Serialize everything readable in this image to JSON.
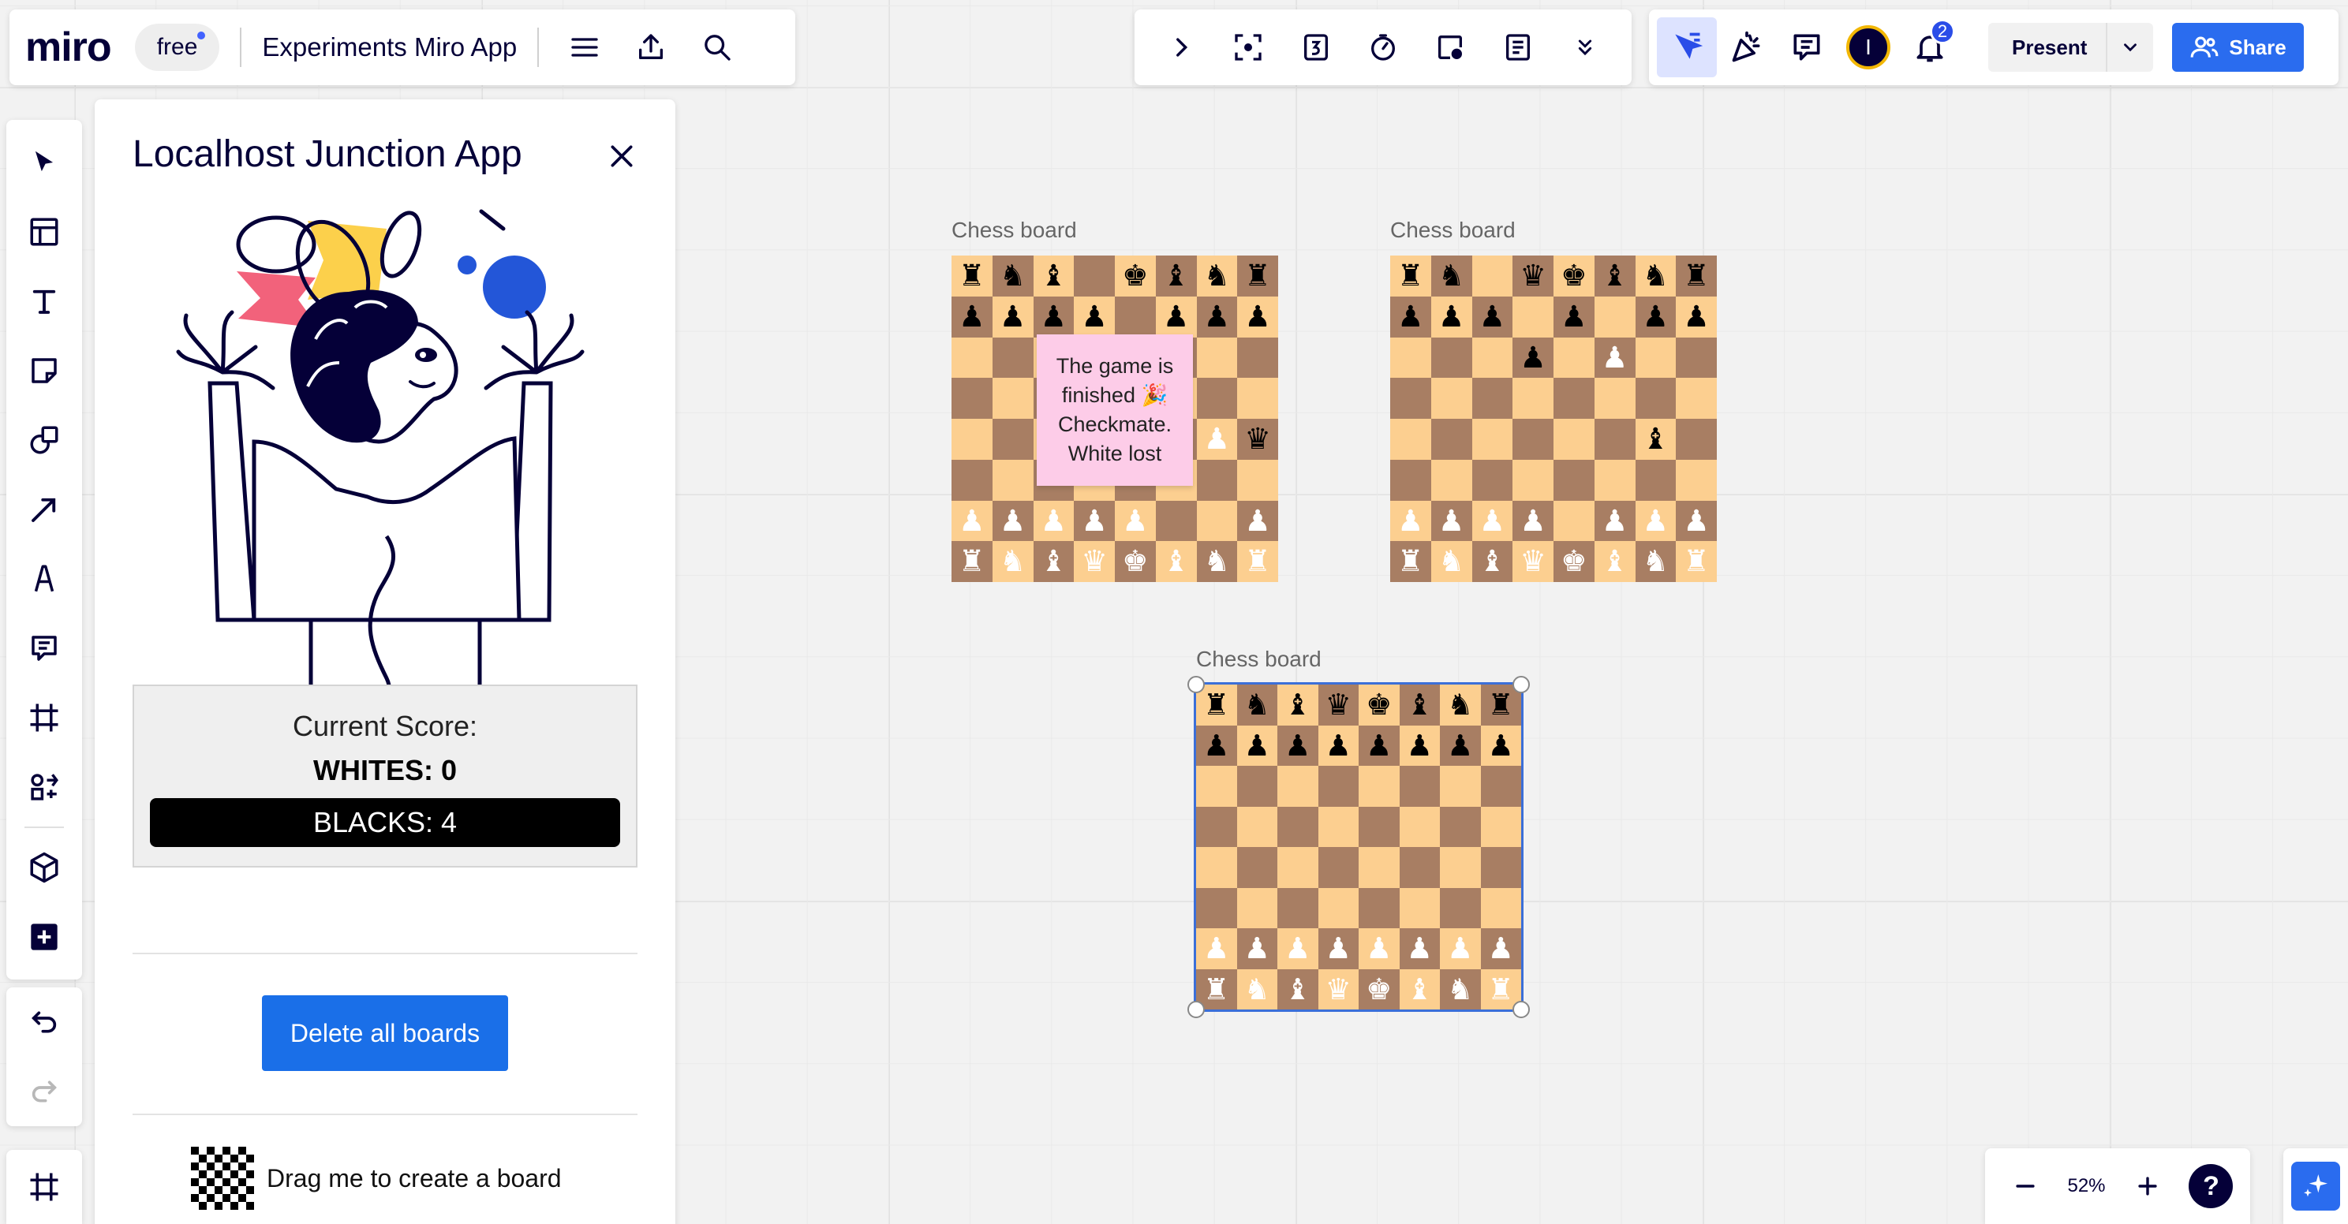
{
  "app": {
    "logo": "miro",
    "plan": "free",
    "board_name": "Experiments Miro App"
  },
  "topbar": {
    "present_label": "Present",
    "share_label": "Share",
    "avatar_initial": "I",
    "notification_count": "2"
  },
  "panel": {
    "title": "Localhost Junction App",
    "score_label": "Current Score:",
    "whites_score": "WHITES: 0",
    "blacks_score": "BLACKS: 4",
    "delete_button": "Delete all boards",
    "drag_label": "Drag me to create a board"
  },
  "canvas": {
    "sticky_note": "The game is finished 🎉 Checkmate. White lost",
    "boards": [
      {
        "caption": "Chess board",
        "rows": [
          "r n b . k b n r",
          "p p p p . p p p",
          ". . . . . . . .",
          ". . . . . . . .",
          ". . . . . . P q",
          ". . . . . . . .",
          "P P P P P . . P",
          "R N B Q K B N R"
        ]
      },
      {
        "caption": "Chess board",
        "rows": [
          "r n . q k b n r",
          "p p p . p . p p",
          ". . . p . P . .",
          ". . . . . . . .",
          ". . . . . . b .",
          ". . . . . . . .",
          "P P P P . P P P",
          "R N B Q K B N R"
        ]
      },
      {
        "caption": "Chess board",
        "rows": [
          "r n b q k b n r",
          "p p p p p p p p",
          ". . . . . . . .",
          ". . . . . . . .",
          ". . . . . . . .",
          ". . . . . . . .",
          "P P P P P P P P",
          "R N B Q K B N R"
        ]
      }
    ]
  },
  "zoom": {
    "level": "52%"
  },
  "colors": {
    "accent": "#2a6cef",
    "light_square": "#fccf90",
    "dark_square": "#a87e63",
    "sticky": "#fdcce8"
  },
  "icons": {
    "left_toolbar": [
      "select-icon",
      "templates-icon",
      "text-icon",
      "sticky-note-icon",
      "shapes-icon",
      "arrow-icon",
      "pen-icon",
      "comment-icon",
      "frame-icon",
      "more-apps-icon",
      "3d-cube-icon",
      "add-icon"
    ],
    "top_toolbar": [
      "chevron-right-icon",
      "focus-icon",
      "counter-icon",
      "timer-icon",
      "card-icon",
      "notes-icon",
      "chevron-double-down-icon"
    ]
  }
}
